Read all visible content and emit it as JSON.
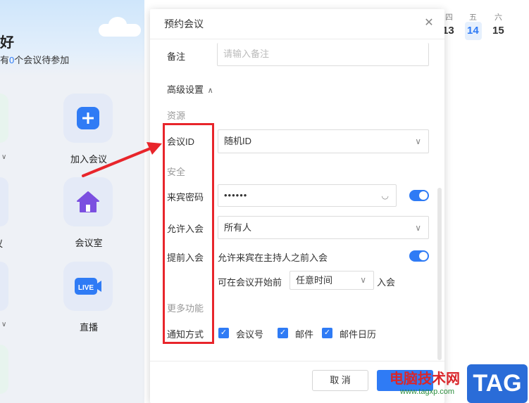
{
  "left_panel": {
    "greeting_fragment": "好",
    "sub_prefix": "有",
    "pending_count": "0",
    "sub_suffix": "个会议待参加",
    "tiles": [
      {
        "label": "加入会议",
        "icon": "plus-icon"
      },
      {
        "label": "会议室",
        "icon": "home-icon"
      },
      {
        "label": "直播",
        "icon": "live-icon"
      }
    ],
    "partial_label": "议"
  },
  "calendar": {
    "days": [
      "四",
      "五",
      "六"
    ],
    "dates": [
      "13",
      "14",
      "15"
    ],
    "today_index": 1
  },
  "dialog": {
    "title": "预约会议",
    "remark": {
      "label": "备注",
      "placeholder": "请输入备注"
    },
    "advanced": {
      "label": "高级设置",
      "expanded": true
    },
    "sections": {
      "resource": "资源",
      "security": "安全",
      "more": "更多功能"
    },
    "meeting_id": {
      "label": "会议ID",
      "value": "随机ID"
    },
    "password": {
      "label": "来宾密码",
      "value": "••••••",
      "enabled": true
    },
    "allow_join": {
      "label": "允许入会",
      "value": "所有人"
    },
    "early_join": {
      "label": "提前入会",
      "desc": "允许来宾在主持人之前入会",
      "enabled": true,
      "prefix": "可在会议开始前",
      "time_value": "任意时间",
      "suffix": "入会"
    },
    "notify": {
      "label": "通知方式",
      "options": [
        {
          "label": "会议号",
          "checked": true
        },
        {
          "label": "邮件",
          "checked": true
        },
        {
          "label": "邮件日历",
          "checked": true
        }
      ]
    },
    "cancel_label": "取 消"
  },
  "watermark": {
    "text": "电脑技术网",
    "url": "www.tagxp.com",
    "logo": "TAG"
  },
  "colors": {
    "accent": "#2f7bf5",
    "annotation": "#e8252b"
  }
}
